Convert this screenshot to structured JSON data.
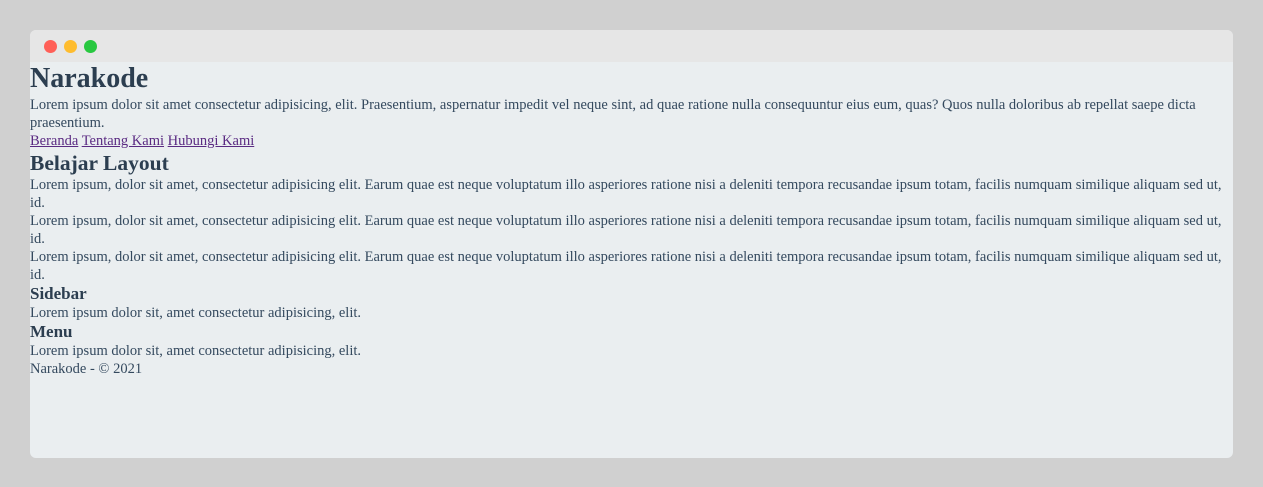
{
  "window": {
    "controls": [
      "close",
      "minimize",
      "maximize"
    ]
  },
  "header": {
    "title": "Narakode",
    "description": "Lorem ipsum dolor sit amet consectetur adipisicing, elit. Praesentium, aspernatur impedit vel neque sint, ad quae ratione nulla consequuntur eius eum, quas? Quos nulla doloribus ab repellat saepe dicta praesentium."
  },
  "nav": {
    "links": [
      "Beranda",
      "Tentang Kami",
      "Hubungi Kami"
    ]
  },
  "main": {
    "heading": "Belajar Layout",
    "paragraphs": [
      "Lorem ipsum, dolor sit amet, consectetur adipisicing elit. Earum quae est neque voluptatum illo asperiores ratione nisi a deleniti tempora recusandae ipsum totam, facilis numquam similique aliquam sed ut, id.",
      "Lorem ipsum, dolor sit amet, consectetur adipisicing elit. Earum quae est neque voluptatum illo asperiores ratione nisi a deleniti tempora recusandae ipsum totam, facilis numquam similique aliquam sed ut, id.",
      "Lorem ipsum, dolor sit amet, consectetur adipisicing elit. Earum quae est neque voluptatum illo asperiores ratione nisi a deleniti tempora recusandae ipsum totam, facilis numquam similique aliquam sed ut, id."
    ]
  },
  "sidebar": {
    "heading": "Sidebar",
    "text": "Lorem ipsum dolor sit, amet consectetur adipisicing, elit."
  },
  "menu": {
    "heading": "Menu",
    "text": "Lorem ipsum dolor sit, amet consectetur adipisicing, elit."
  },
  "footer": {
    "text": "Narakode - © 2021"
  },
  "colors": {
    "close": "#ff5f57",
    "minimize": "#febc2e",
    "maximize": "#28c840",
    "text": "#34495e",
    "link": "#5a2a82"
  }
}
